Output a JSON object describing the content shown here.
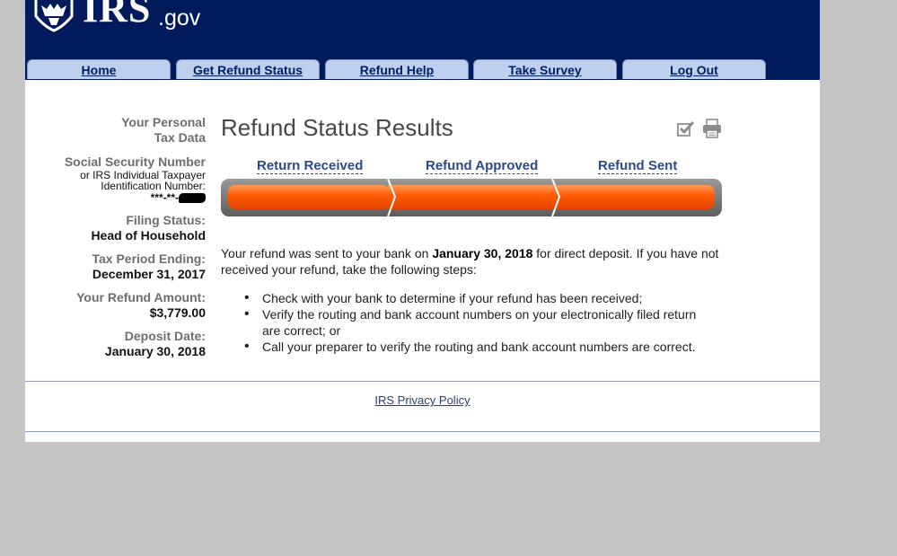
{
  "header": {
    "logo_text": "IRS",
    "logo_domain": ".gov"
  },
  "nav": {
    "tabs": [
      {
        "label": "Home"
      },
      {
        "label": "Get Refund Status"
      },
      {
        "label": "Refund Help"
      },
      {
        "label": "Take Survey"
      },
      {
        "label": "Log Out"
      }
    ]
  },
  "sidebar": {
    "personal_line1": "Your Personal",
    "personal_line2": "Tax Data",
    "ssn_label": "Social Security Number",
    "ssn_sub1": "or IRS Individual Taxpayer",
    "ssn_sub2": "Identification Number:",
    "ssn_value": "***-**-",
    "filing_status_label": "Filing Status:",
    "filing_status_value": "Head of Household",
    "tax_period_label": "Tax Period Ending:",
    "tax_period_value": "December 31, 2017",
    "refund_amount_label": "Your Refund Amount:",
    "refund_amount_value": "$3,779.00",
    "deposit_date_label": "Deposit Date:",
    "deposit_date_value": "January 30, 2018"
  },
  "main": {
    "title": "Refund Status Results",
    "stages": [
      "Return Received",
      "Refund Approved",
      "Refund Sent"
    ],
    "progress_completed_stages": 3,
    "message_part1": "Your refund was sent to your bank on ",
    "message_date": "January 30, 2018",
    "message_part2": " for direct deposit. If you have not received your refund, take the following steps:",
    "steps": [
      "Check with your bank to determine if your refund has been received;",
      "Verify the routing and bank account numbers on your electronically filed return are correct; or",
      "Call your preparer to verify the routing and bank account numbers are correct."
    ]
  },
  "footer": {
    "privacy_link": "IRS Privacy Policy"
  },
  "colors": {
    "header_bg": "#001a5c",
    "tab_bg": "#bfd0ee",
    "progress_orange": "#ff5a00",
    "progress_track": "#7a7a7a",
    "link_blue": "#2b4a8a"
  }
}
